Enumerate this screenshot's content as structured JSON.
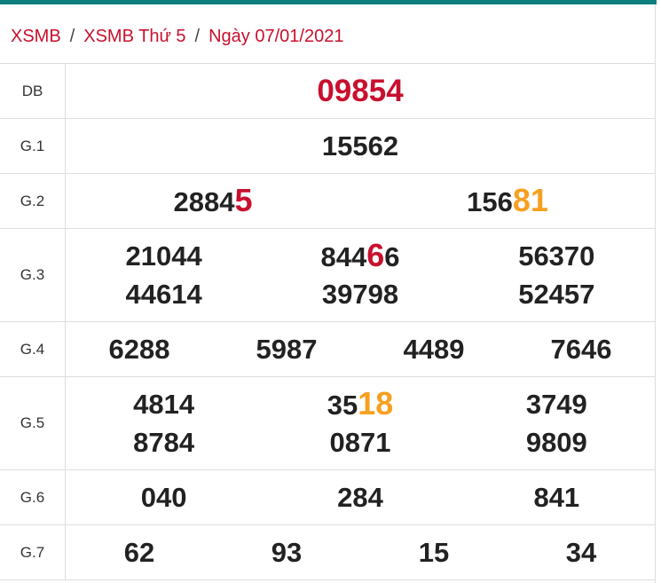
{
  "breadcrumb": {
    "home": "XSMB",
    "section": "XSMB Thứ 5",
    "current": "Ngày 07/01/2021",
    "separator": "/"
  },
  "colors": {
    "accent_bar": "#0e7f7f",
    "brand_red": "#c8102e",
    "highlight_orange": "#f7a020"
  },
  "results": [
    {
      "label": "DB",
      "numbers": [
        {
          "base": "09854",
          "tail": "",
          "tail_color": ""
        }
      ]
    },
    {
      "label": "G.1",
      "numbers": [
        {
          "base": "15562",
          "tail": "",
          "tail_color": ""
        }
      ]
    },
    {
      "label": "G.2",
      "numbers": [
        {
          "base": "2884",
          "tail": "5",
          "tail_color": "red"
        },
        {
          "base": "156",
          "tail": "81",
          "tail_color": "orange"
        }
      ]
    },
    {
      "label": "G.3",
      "numbers": [
        {
          "base": "21044",
          "tail": "",
          "tail_color": ""
        },
        {
          "base": "844",
          "tail": "6",
          "rest": "6",
          "tail_color": "red"
        },
        {
          "base": "56370",
          "tail": "",
          "tail_color": ""
        },
        {
          "base": "44614",
          "tail": "",
          "tail_color": ""
        },
        {
          "base": "39798",
          "tail": "",
          "tail_color": ""
        },
        {
          "base": "52457",
          "tail": "",
          "tail_color": ""
        }
      ]
    },
    {
      "label": "G.4",
      "numbers": [
        {
          "base": "6288"
        },
        {
          "base": "5987"
        },
        {
          "base": "4489"
        },
        {
          "base": "7646"
        }
      ]
    },
    {
      "label": "G.5",
      "numbers": [
        {
          "base": "4814",
          "tail": "",
          "tail_color": ""
        },
        {
          "base": "35",
          "tail": "18",
          "tail_color": "orange"
        },
        {
          "base": "3749",
          "tail": "",
          "tail_color": ""
        },
        {
          "base": "8784",
          "tail": "",
          "tail_color": ""
        },
        {
          "base": "0871",
          "tail": "",
          "tail_color": ""
        },
        {
          "base": "9809",
          "tail": "",
          "tail_color": ""
        }
      ]
    },
    {
      "label": "G.6",
      "numbers": [
        {
          "base": "040"
        },
        {
          "base": "284"
        },
        {
          "base": "841"
        }
      ]
    },
    {
      "label": "G.7",
      "numbers": [
        {
          "base": "62"
        },
        {
          "base": "93"
        },
        {
          "base": "15"
        },
        {
          "base": "34"
        }
      ]
    }
  ]
}
